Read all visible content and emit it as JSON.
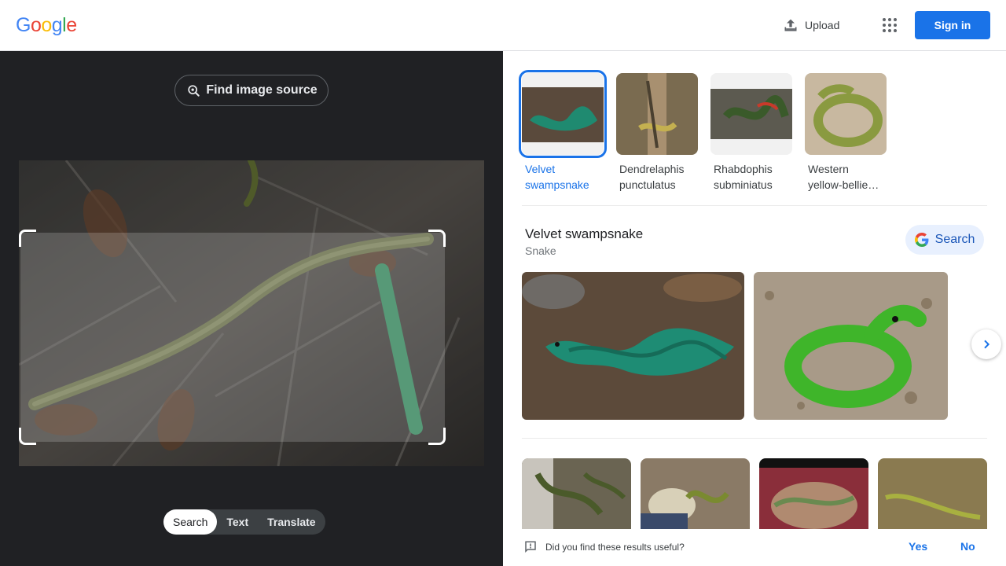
{
  "header": {
    "logo_letters": [
      {
        "ch": "G",
        "color": "#4285F4"
      },
      {
        "ch": "o",
        "color": "#EA4335"
      },
      {
        "ch": "o",
        "color": "#FBBC05"
      },
      {
        "ch": "g",
        "color": "#4285F4"
      },
      {
        "ch": "l",
        "color": "#34A853"
      },
      {
        "ch": "e",
        "color": "#EA4335"
      }
    ],
    "upload_label": "Upload",
    "upload_icon": "upload-icon",
    "apps_icon": "apps-grid-icon",
    "signin_label": "Sign in"
  },
  "left": {
    "find_source_label": "Find image source",
    "find_source_icon": "lens-search-icon",
    "modes": [
      "Search",
      "Text",
      "Translate"
    ],
    "active_mode": "Search"
  },
  "right": {
    "thumbs": [
      {
        "label": "Velvet swampsnake",
        "selected": true
      },
      {
        "label": "Dendrelaphis punctulatus",
        "selected": false
      },
      {
        "label": "Rhabdophis subminiatus",
        "selected": false
      },
      {
        "label": "Western yellow-bellie…",
        "selected": false
      }
    ],
    "entity": {
      "title": "Velvet swampsnake",
      "subtitle": "Snake",
      "search_label": "Search"
    },
    "feedback": {
      "question": "Did you find these results useful?",
      "yes": "Yes",
      "no": "No"
    }
  },
  "colors": {
    "accent": "#1a73e8",
    "dark_bg": "#202124"
  }
}
